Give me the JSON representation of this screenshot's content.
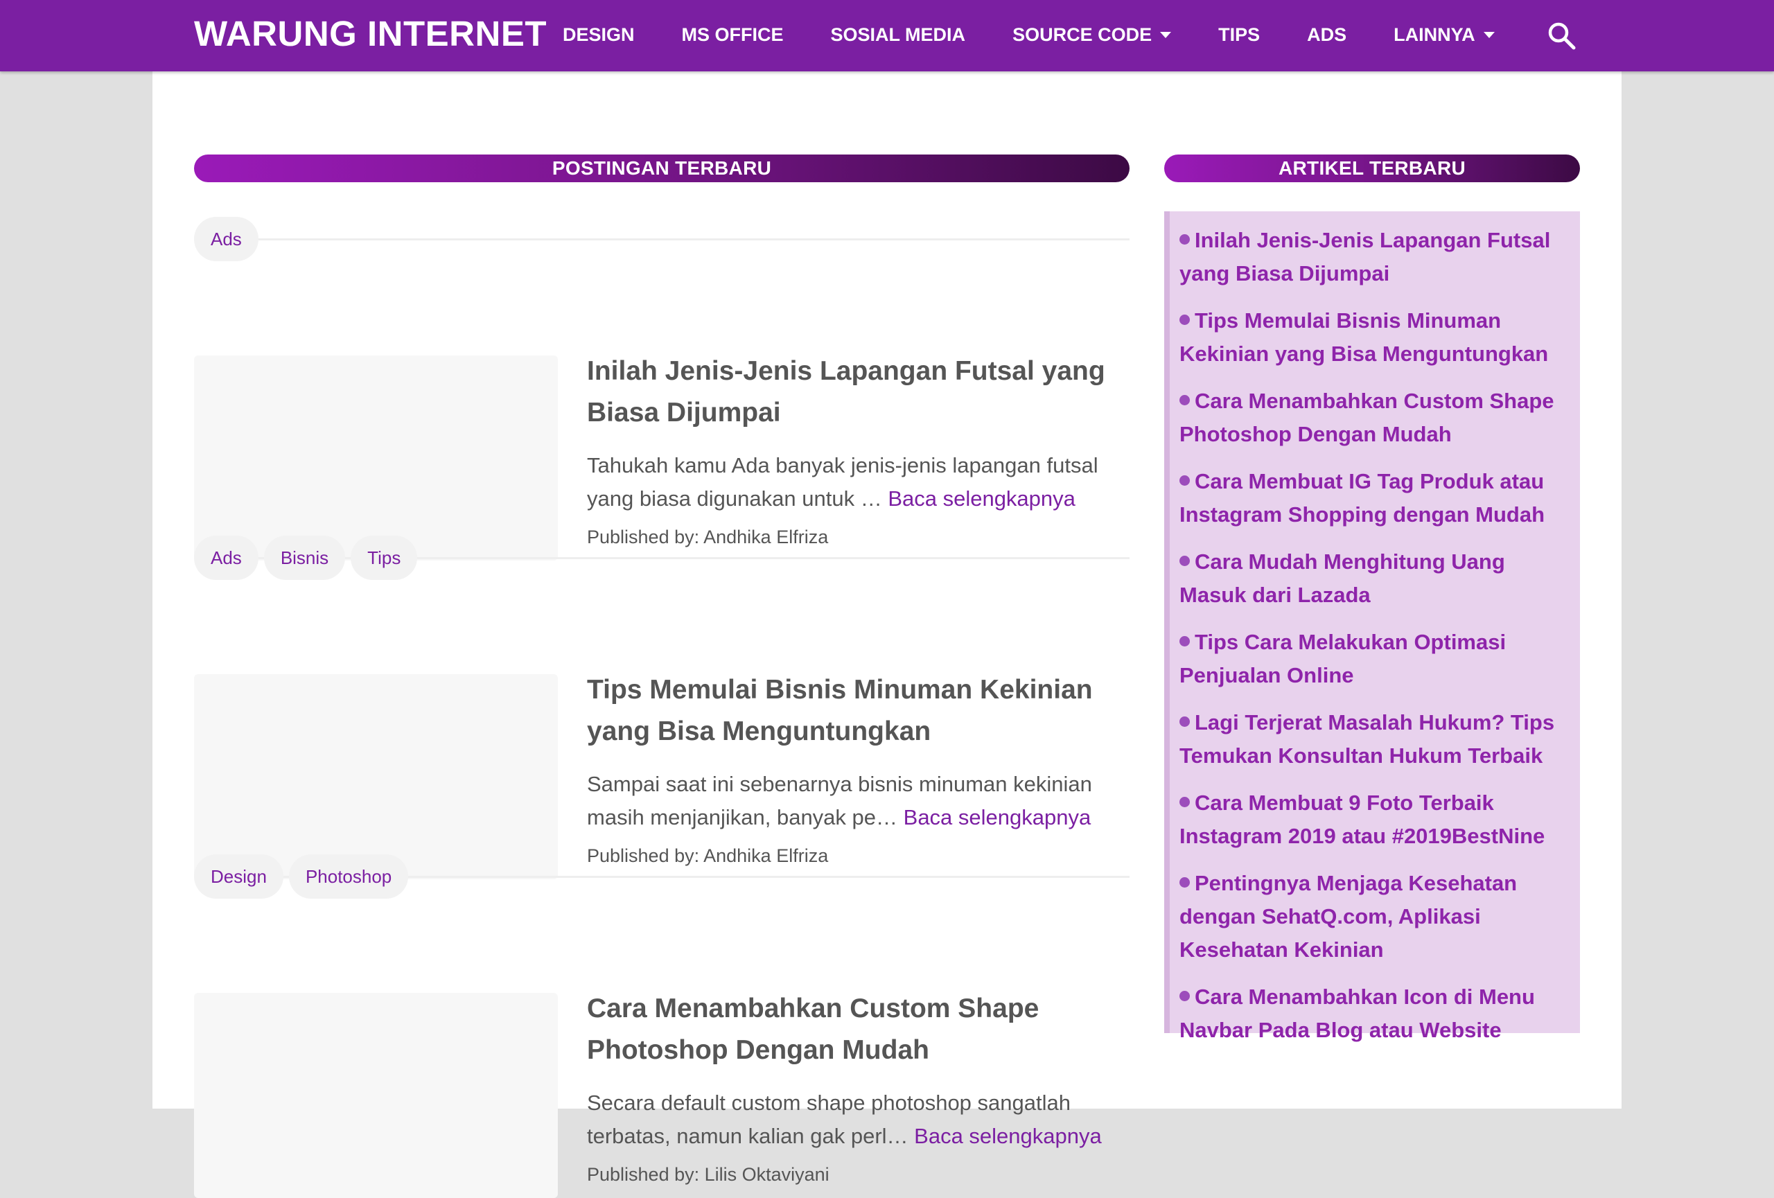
{
  "brand": "WARUNG INTERNET",
  "nav": [
    {
      "label": "DESIGN",
      "dropdown": false
    },
    {
      "label": "MS OFFICE",
      "dropdown": false
    },
    {
      "label": "SOSIAL MEDIA",
      "dropdown": false
    },
    {
      "label": "SOURCE CODE",
      "dropdown": true
    },
    {
      "label": "TIPS",
      "dropdown": false
    },
    {
      "label": "ADS",
      "dropdown": false
    },
    {
      "label": "LAINNYA",
      "dropdown": true
    }
  ],
  "search_icon": "search-icon",
  "colors": {
    "brand": "#7b1fa2",
    "accent_text": "#8e24aa",
    "sidebar_bg": "#e8d2ed"
  },
  "main": {
    "section_title": "POSTINGAN TERBARU",
    "posts": [
      {
        "tags": [
          "Ads"
        ],
        "title": "Inilah Jenis-Jenis Lapangan Futsal yang Biasa Dijumpai",
        "excerpt": "Tahukah kamu Ada banyak jenis-jenis lapangan futsal yang biasa digunakan untuk … ",
        "read_more": "Baca selengkapnya",
        "author": "Published by: Andhika Elfriza"
      },
      {
        "tags": [
          "Ads",
          "Bisnis",
          "Tips"
        ],
        "title": "Tips Memulai Bisnis Minuman Kekinian yang Bisa Menguntungkan",
        "excerpt": "Sampai saat ini sebenarnya bisnis minuman kekinian masih menjanjikan, banyak pe… ",
        "read_more": "Baca selengkapnya",
        "author": "Published by: Andhika Elfriza"
      },
      {
        "tags": [
          "Design",
          "Photoshop"
        ],
        "title": "Cara Menambahkan Custom Shape Photoshop Dengan Mudah",
        "excerpt": "Secara default custom shape photoshop sangatlah terbatas, namun kalian gak perl… ",
        "read_more": "Baca selengkapnya",
        "author": "Published by: Lilis Oktaviyani"
      }
    ]
  },
  "sidebar": {
    "title": "ARTIKEL TERBARU",
    "items": [
      "Inilah Jenis-Jenis Lapangan Futsal yang Biasa Dijumpai",
      "Tips Memulai Bisnis Minuman Kekinian yang Bisa Menguntungkan",
      "Cara Menambahkan Custom Shape Photoshop Dengan Mudah",
      "Cara Membuat IG Tag Produk atau Instagram Shopping dengan Mudah",
      "Cara Mudah Menghitung Uang Masuk dari Lazada",
      "Tips Cara Melakukan Optimasi Penjualan Online",
      "Lagi Terjerat Masalah Hukum? Tips Temukan Konsultan Hukum Terbaik",
      "Cara Membuat 9 Foto Terbaik Instagram 2019 atau #2019BestNine",
      "Pentingnya Menjaga Kesehatan dengan SehatQ.com, Aplikasi Kesehatan Kekinian",
      "Cara Menambahkan Icon di Menu Navbar Pada Blog atau Website"
    ]
  }
}
